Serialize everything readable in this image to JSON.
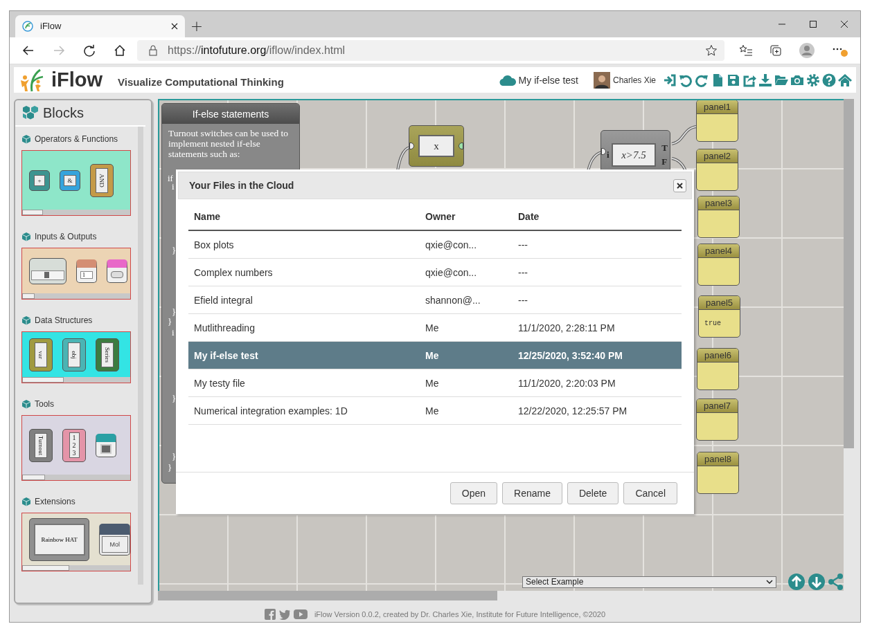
{
  "browser": {
    "tab_title": "iFlow",
    "new_tab": "+",
    "url_scheme": "https://",
    "url_host": "intofuture.org",
    "url_path": "/iflow/index.html",
    "forward_disabled": true
  },
  "header": {
    "app_name": "iFlow",
    "tagline": "Visualize Computational Thinking",
    "file_name": "My if-else test",
    "user_name": "Charles Xie"
  },
  "sidebar": {
    "title": "Blocks",
    "sections": [
      {
        "label": "Operators & Functions",
        "color": "#8ee6c9",
        "items": [
          {
            "kind": "block",
            "label": "+",
            "color": "#3d9490"
          },
          {
            "kind": "block",
            "label": "&",
            "color": "#35a4dc"
          },
          {
            "kind": "tall-block",
            "label": "AND",
            "color": "#c49a48"
          }
        ]
      },
      {
        "label": "Inputs & Outputs",
        "color": "#ecd4b4",
        "items": [
          {
            "kind": "slider",
            "color": "#d7ddd8"
          },
          {
            "kind": "dropdown",
            "label": "1",
            "color": "#d48e74"
          },
          {
            "kind": "toggle",
            "color": "#e868c8"
          }
        ]
      },
      {
        "label": "Data Structures",
        "color": "#33e4e4",
        "items": [
          {
            "kind": "tall-block",
            "label": "var",
            "color": "#a09a40"
          },
          {
            "kind": "tall-block",
            "label": "obj",
            "color": "#4ab4b4"
          },
          {
            "kind": "tall-block",
            "label": "Series",
            "color": "#3c7c40"
          }
        ]
      },
      {
        "label": "Tools",
        "color": "#d9d6e2",
        "items": [
          {
            "kind": "tall-block",
            "label": "Turnout",
            "color": "#808080"
          },
          {
            "kind": "list",
            "lines": [
              "1",
              "2",
              "3"
            ],
            "color": "#e494a8"
          },
          {
            "kind": "screen",
            "color": "#2aa0a4"
          }
        ]
      },
      {
        "label": "Extensions",
        "color": "#e4e0d0",
        "items": [
          {
            "kind": "board",
            "label": "Rainbow HAT",
            "color": "#909090"
          },
          {
            "kind": "header-block",
            "label": "Mol",
            "color": "#4c5c70"
          }
        ]
      }
    ]
  },
  "canvas": {
    "note": {
      "title": "If-else statements",
      "text": "Turnout switches can be used to implement nested if-else statements such as:",
      "code": [
        "if",
        "i",
        "}",
        "}",
        "}",
        "i",
        "}",
        "}",
        "}"
      ]
    },
    "blocks": [
      {
        "kind": "variable",
        "label": "x"
      },
      {
        "kind": "condition",
        "label": "x>7.5",
        "input": "i",
        "outputs": [
          "T",
          "F"
        ]
      }
    ],
    "panels": [
      {
        "title": "panel1"
      },
      {
        "title": "panel2"
      },
      {
        "title": "panel3"
      },
      {
        "title": "panel4"
      },
      {
        "title": "panel5",
        "content": "true"
      },
      {
        "title": "panel6"
      },
      {
        "title": "panel7"
      },
      {
        "title": "panel8"
      }
    ],
    "example_select": "Select Example"
  },
  "dialog": {
    "title": "Your Files in the Cloud",
    "columns": [
      "Name",
      "Owner",
      "Date"
    ],
    "rows": [
      {
        "name": "Box plots",
        "owner": "qxie@con...",
        "date": "---",
        "selected": false
      },
      {
        "name": "Complex numbers",
        "owner": "qxie@con...",
        "date": "---",
        "selected": false
      },
      {
        "name": "Efield integral",
        "owner": "shannon@...",
        "date": "---",
        "selected": false
      },
      {
        "name": "Mutlithreading",
        "owner": "Me",
        "date": "11/1/2020, 2:28:11 PM",
        "selected": false
      },
      {
        "name": "My if-else test",
        "owner": "Me",
        "date": "12/25/2020, 3:52:40 PM",
        "selected": true
      },
      {
        "name": "My testy file",
        "owner": "Me",
        "date": "11/1/2020, 2:20:03 PM",
        "selected": false
      },
      {
        "name": "Numerical integration examples: 1D",
        "owner": "Me",
        "date": "12/22/2020, 12:25:57 PM",
        "selected": false
      }
    ],
    "buttons": [
      "Open",
      "Rename",
      "Delete",
      "Cancel"
    ]
  },
  "footer": {
    "text": "iFlow Version 0.0.2, created by Dr. Charles Xie, Institute for Future Intelligence, ©2020"
  }
}
